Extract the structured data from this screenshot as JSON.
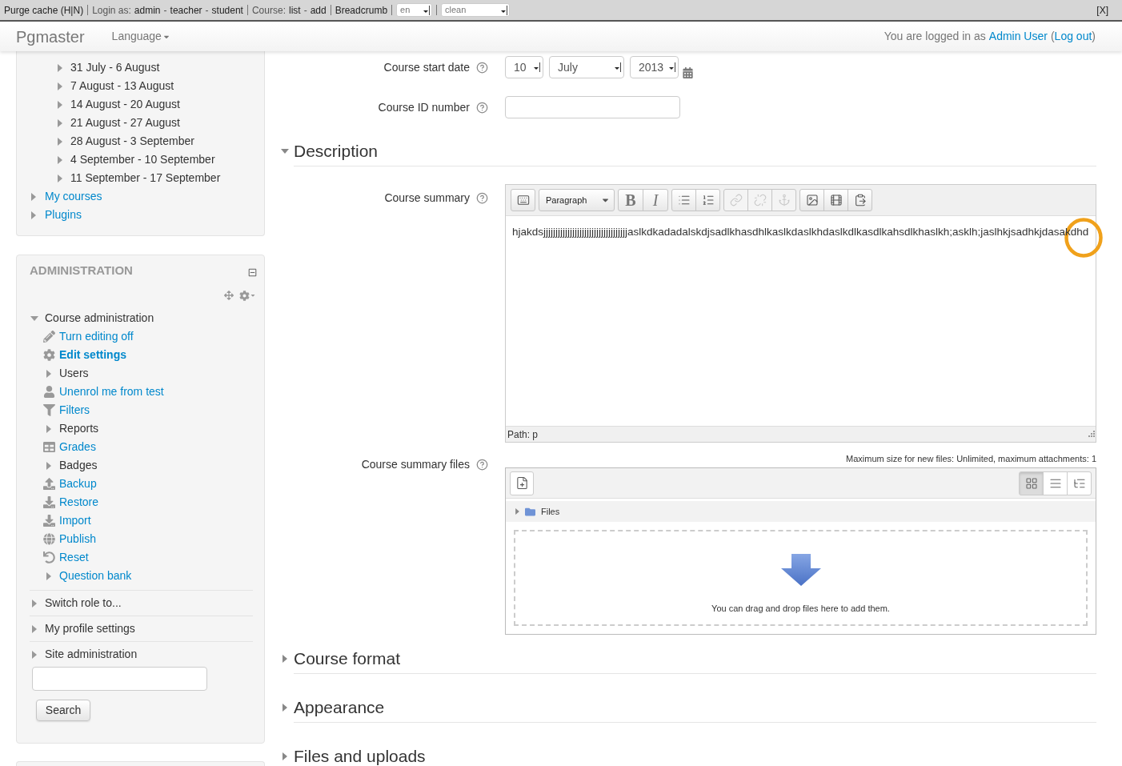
{
  "debug_bar": {
    "groups": [
      {
        "links": [
          "Purge cache (H|N)"
        ]
      },
      {
        "label": "Login as:",
        "links": [
          "admin",
          "teacher",
          "student"
        ],
        "joiner": "-"
      },
      {
        "label": "Course:",
        "links": [
          "list",
          "add"
        ],
        "joiner": "-"
      },
      {
        "links": [
          "Breadcrumb"
        ]
      }
    ],
    "selects": [
      "en",
      "clean"
    ],
    "close": "[X]"
  },
  "header": {
    "site_name": "Pgmaster",
    "language_menu": "Language",
    "login_info": {
      "prefix": "You are logged in as",
      "user": "Admin User",
      "logout": {
        "open": "(",
        "label": "Log out",
        "close": ")"
      }
    }
  },
  "navigation": {
    "weeks": [
      {
        "label": "31 July - 6 August",
        "expanded": false
      },
      {
        "label": "7 August - 13 August",
        "expanded": false
      },
      {
        "label": "14 August - 20 August",
        "expanded": false
      },
      {
        "label": "21 August - 27 August",
        "expanded": false
      },
      {
        "label": "28 August - 3 September",
        "expanded": false
      },
      {
        "label": "4 September - 10 September",
        "expanded": false
      },
      {
        "label": "11 September - 17 September",
        "expanded": false
      }
    ],
    "items": [
      {
        "label": "My courses",
        "expanded": false
      },
      {
        "label": "Plugins",
        "expanded": false
      }
    ]
  },
  "administration": {
    "title": "ADMINISTRATION",
    "tree": [
      {
        "label": "Course administration",
        "expanded": true,
        "children": [
          {
            "label": "Turn editing off",
            "kind": "link",
            "current": false
          },
          {
            "label": "Edit settings",
            "kind": "link",
            "current": true
          },
          {
            "label": "Users",
            "kind": "branch",
            "expanded": false,
            "current": false
          },
          {
            "label": "Unenrol me from test",
            "kind": "link",
            "current": false
          },
          {
            "label": "Filters",
            "kind": "link",
            "current": false
          },
          {
            "label": "Reports",
            "kind": "branch",
            "expanded": false,
            "current": false
          },
          {
            "label": "Grades",
            "kind": "link",
            "current": false
          },
          {
            "label": "Badges",
            "kind": "branch",
            "expanded": false,
            "current": false
          },
          {
            "label": "Backup",
            "kind": "link",
            "current": false
          },
          {
            "label": "Restore",
            "kind": "link",
            "current": false
          },
          {
            "label": "Import",
            "kind": "link",
            "current": false
          },
          {
            "label": "Publish",
            "kind": "link",
            "current": false
          },
          {
            "label": "Reset",
            "kind": "link",
            "current": false
          },
          {
            "label": "Question bank",
            "kind": "link_branch",
            "expanded": false,
            "current": false
          }
        ]
      },
      {
        "label": "Switch role to...",
        "expanded": false
      },
      {
        "label": "My profile settings",
        "expanded": false
      },
      {
        "label": "Site administration",
        "expanded": false
      }
    ],
    "search_button": "Search"
  },
  "form": {
    "fields": [
      {
        "kind": "date",
        "label": "Course start date",
        "day": "10",
        "month": "July",
        "year": "2013"
      },
      {
        "kind": "text",
        "label": "Course ID number"
      }
    ],
    "description": {
      "title": "Description",
      "expanded": true,
      "summary": {
        "label": "Course summary",
        "toolbar": [
          {
            "kind": "buttons",
            "buttons": [
              {
                "disabled": false
              }
            ]
          },
          {
            "kind": "select",
            "value": "Paragraph"
          },
          {
            "kind": "buttons",
            "buttons": [
              {
                "label": "B",
                "disabled": false
              },
              {
                "label": "I",
                "disabled": false
              }
            ]
          },
          {
            "kind": "buttons",
            "buttons": [
              {
                "disabled": false
              },
              {
                "disabled": false
              }
            ]
          },
          {
            "kind": "buttons",
            "buttons": [
              {
                "disabled": true
              },
              {
                "disabled": true
              },
              {
                "disabled": true
              }
            ]
          },
          {
            "kind": "buttons",
            "buttons": [
              {
                "disabled": false
              },
              {
                "disabled": false
              },
              {
                "disabled": false
              }
            ]
          }
        ],
        "content": "hjakdsjjjjjjjjjjjjjjjjjjjjjjjjjjjjjjjjjjjaslkdkadadalskdjsadlkhasdhlkaslkdaslkhdaslkdlkasdlkahsdlkhaslkh;asklh;jaslhkjsadhkjdasakdhd",
        "path": "Path: p"
      },
      "files": {
        "label": "Course summary files",
        "limits": "Maximum size for new files: Unlimited, maximum attachments: 1",
        "folder": {
          "label": "Files",
          "expanded": false
        },
        "views": [
          {
            "selected": true
          },
          {
            "selected": false
          },
          {
            "selected": false
          }
        ],
        "drop_hint": "You can drag and drop files here to add them."
      }
    },
    "sections": [
      {
        "title": "Course format",
        "expanded": false
      },
      {
        "title": "Appearance",
        "expanded": false
      },
      {
        "title": "Files and uploads",
        "expanded": false
      }
    ]
  }
}
